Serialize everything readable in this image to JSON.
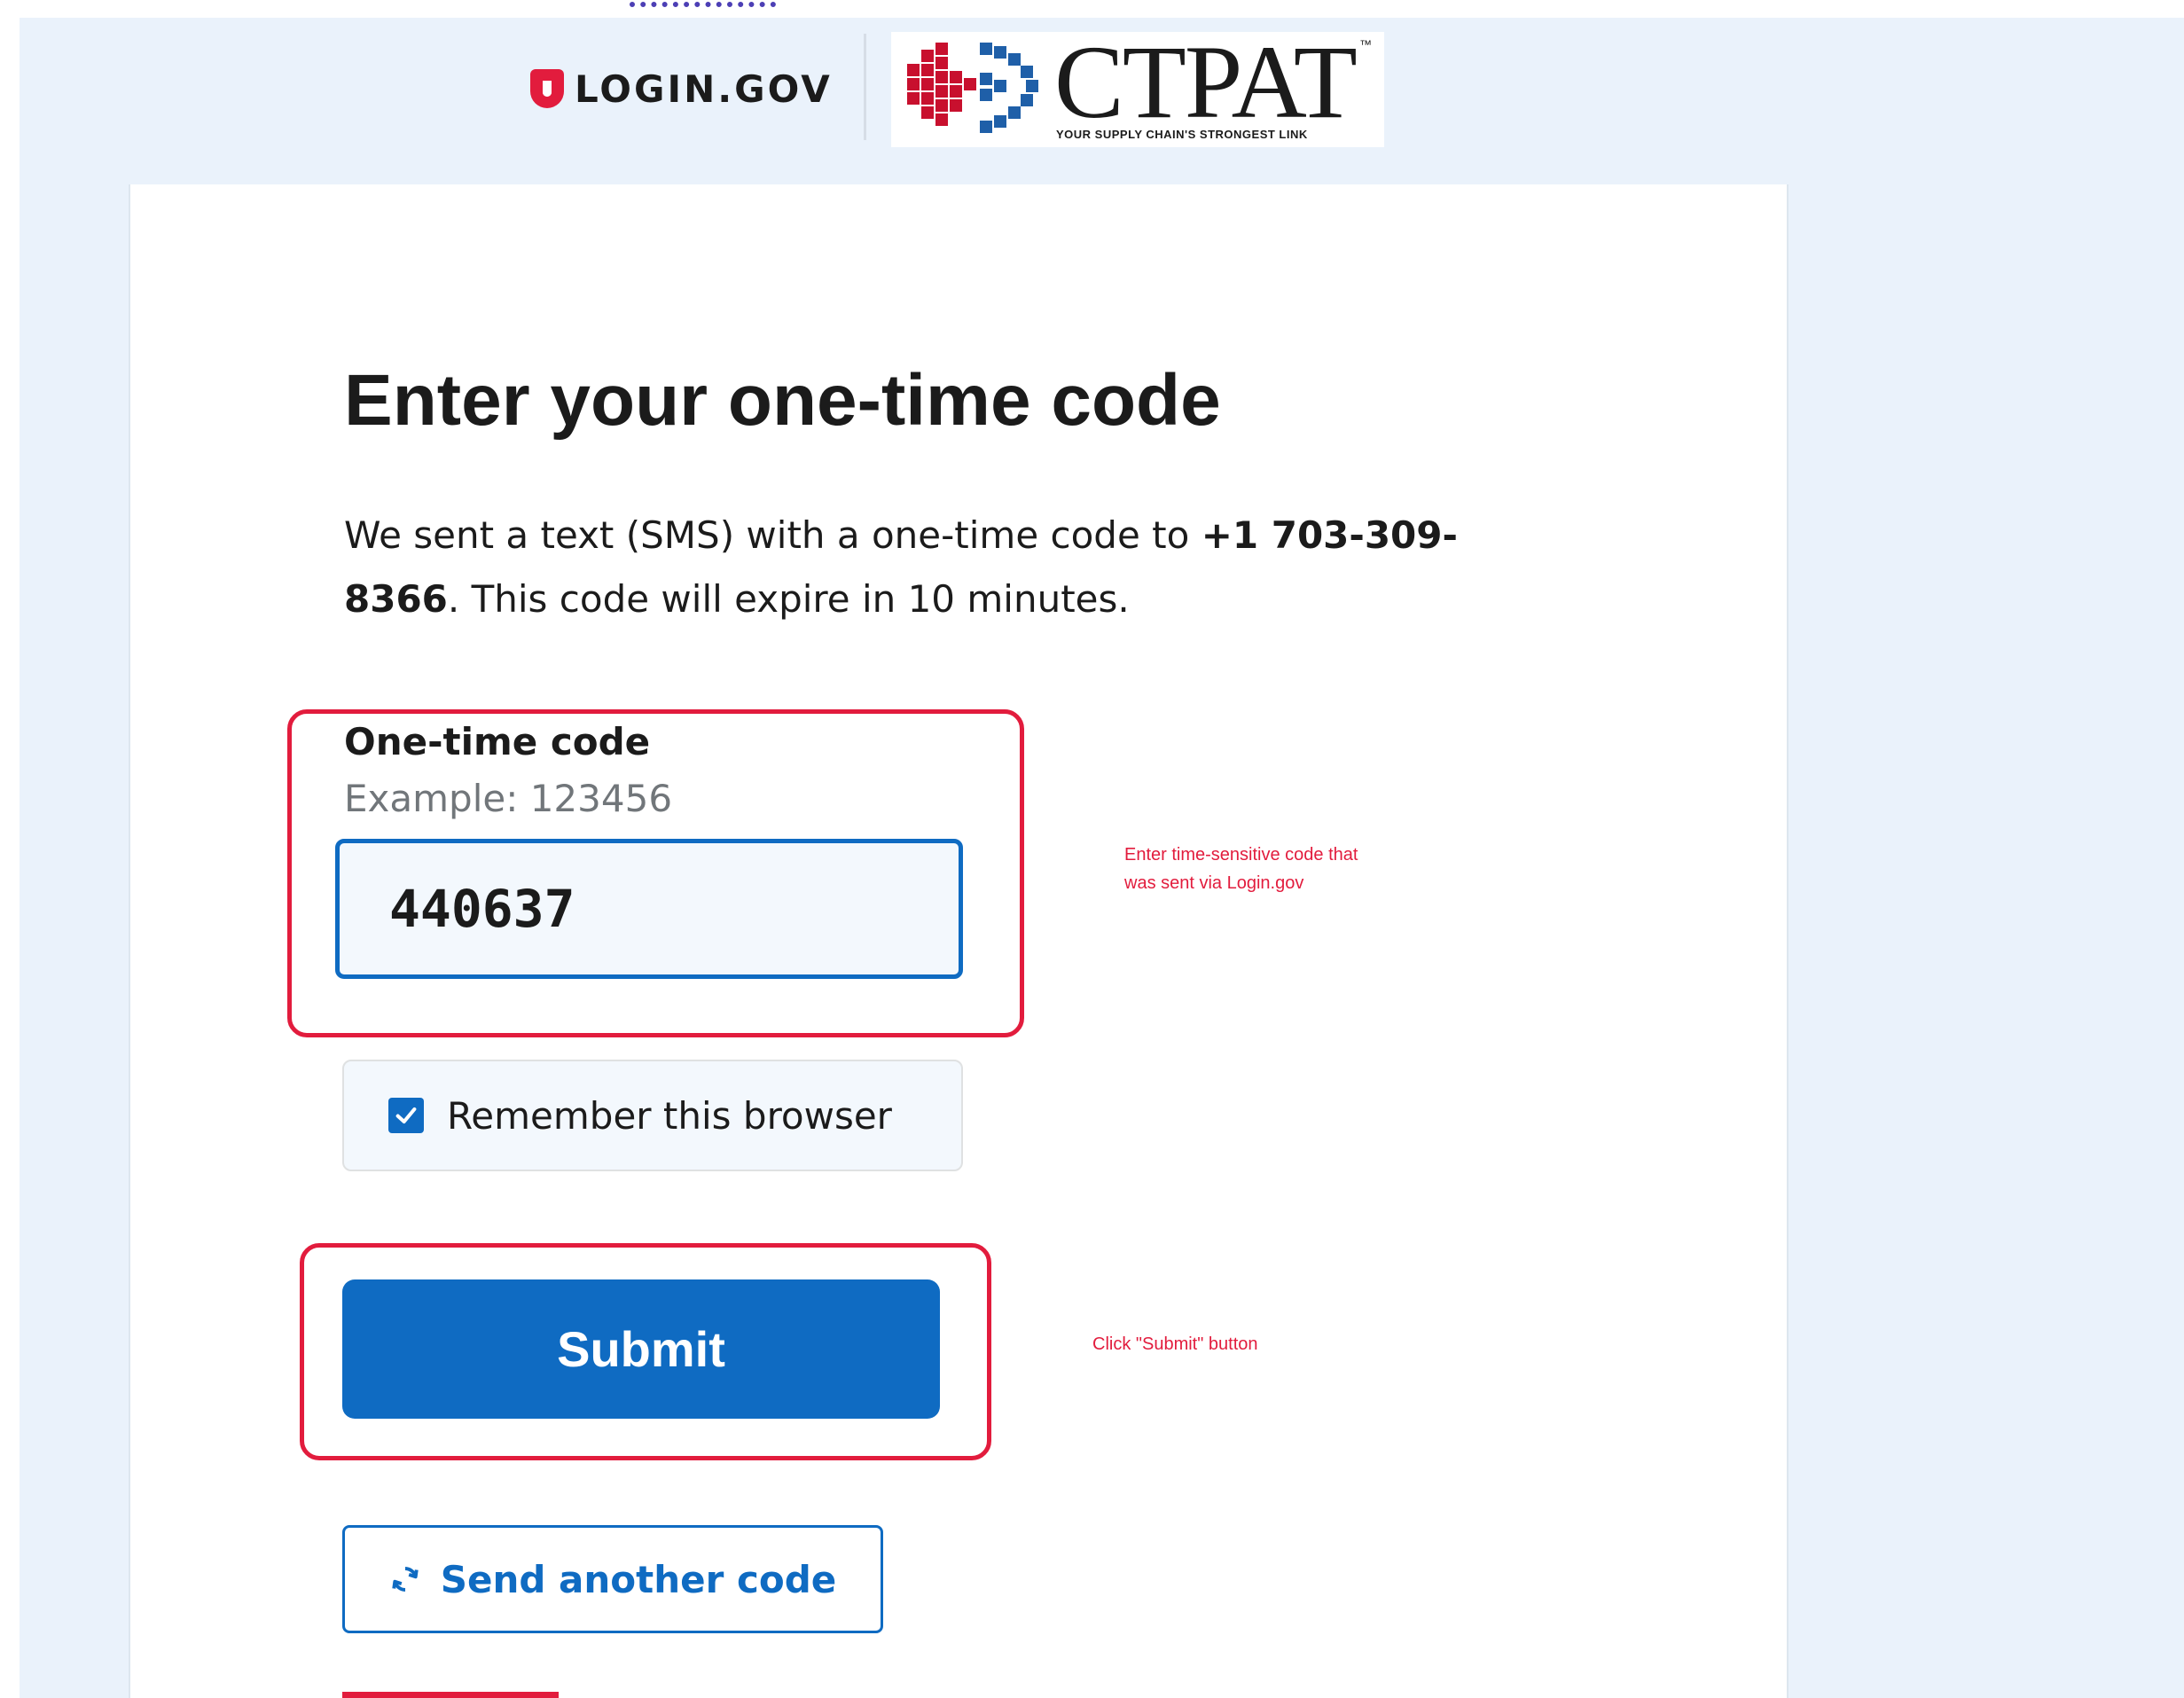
{
  "header": {
    "login_logo_text": "LOGIN.GOV",
    "partner_logo_text": "CTPAT",
    "partner_logo_tm": "™",
    "partner_tagline": "YOUR SUPPLY CHAIN'S STRONGEST LINK"
  },
  "page": {
    "heading": "Enter your one-time code",
    "intro_before": "We sent a text (SMS) with a one-time code to ",
    "intro_phone": "+1 703-309-8366",
    "intro_after": ". This code will expire in 10 minutes."
  },
  "form": {
    "code_label": "One-time code",
    "code_hint": "Example: 123456",
    "code_value": "440637",
    "remember_label": "Remember this browser",
    "remember_checked": true,
    "submit_label": "Submit",
    "send_another_label": "Send another code"
  },
  "annotations": {
    "code_note_line1": "Enter time-sensitive code that",
    "code_note_line2": "was sent via Login.gov",
    "submit_note": "Click \"Submit\" button"
  },
  "colors": {
    "primary": "#0f6bc2",
    "highlight": "#e21c3d",
    "page_background": "#eaf2fb"
  }
}
